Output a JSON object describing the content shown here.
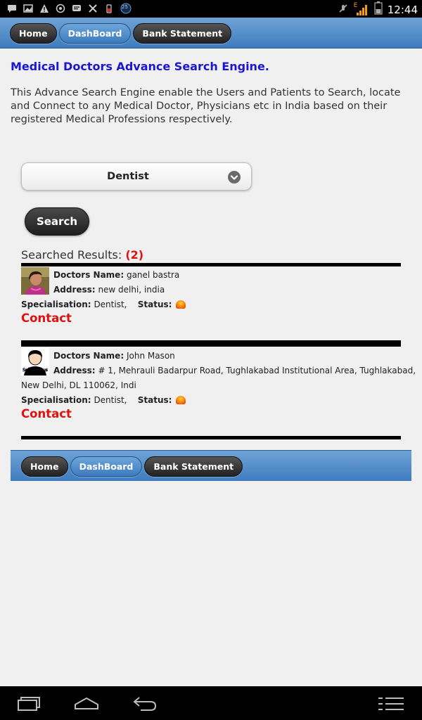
{
  "status_bar": {
    "time": "12:44",
    "badge": "25",
    "signal_label": "E",
    "icons_left": [
      "message-icon",
      "gallery-icon",
      "warning-icon",
      "whatsapp-icon",
      "chat-icon",
      "tools-icon",
      "battery-app-icon",
      "app-25-icon"
    ],
    "icons_right": [
      "mute-icon",
      "signal-icon",
      "battery-icon"
    ]
  },
  "header_nav": {
    "home": "Home",
    "dashboard": "DashBoard",
    "bank_statement": "Bank Statement"
  },
  "page": {
    "title": "Medical Doctors Advance Search Engine.",
    "description": "This Advance Search Engine enable the Users and Patients to Search, locate and Connect to any Medical Doctor, Physicians etc in India based on their registered Medical Professions respectively."
  },
  "search": {
    "selected_specialisation": "Dentist",
    "button_label": "Search"
  },
  "results": {
    "label": "Searched Results: ",
    "count": "(2)",
    "items": [
      {
        "name_label": "Doctors Name:",
        "name": "ganel bastra",
        "address_label": "Address:",
        "address": "new delhi, india",
        "address_cont": "",
        "specialisation_label": "Specialisation:",
        "specialisation": "Dentist,",
        "status_label": "Status:",
        "contact": "Contact"
      },
      {
        "name_label": "Doctors Name:",
        "name": "John Mason",
        "address_label": "Address:",
        "address": "# 1, Mehrauli Badarpur Road, Tughlakabad Institutional Area, Tughlakabad,",
        "address_cont": "New Delhi, DL 110062, Indi",
        "specialisation_label": "Specialisation:",
        "specialisation": "Dentist,",
        "status_label": "Status:",
        "contact": "Contact"
      }
    ]
  },
  "footer_nav": {
    "home": "Home",
    "dashboard": "DashBoard",
    "bank_statement": "Bank Statement"
  },
  "system_nav": {
    "icons": [
      "recent-apps-icon",
      "home-icon",
      "back-icon",
      "menu-icon"
    ]
  },
  "colors": {
    "title": "#1b16d6",
    "accent_red": "#e0120f",
    "bar_blue": "#4f89c7"
  }
}
